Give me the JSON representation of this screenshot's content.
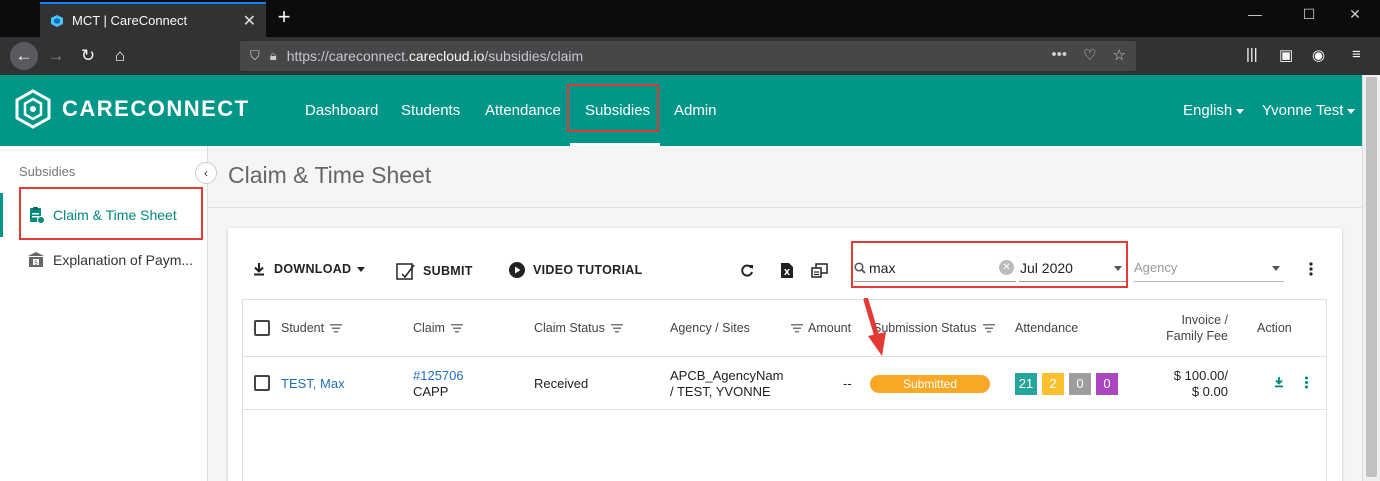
{
  "browser": {
    "tab_title": "MCT | CareConnect",
    "url_prefix": "https://careconnect.",
    "url_host": "carecloud.io",
    "url_path": "/subsidies/claim"
  },
  "app": {
    "brand": "CARECONNECT",
    "nav": [
      {
        "label": "Dashboard"
      },
      {
        "label": "Students"
      },
      {
        "label": "Attendance"
      },
      {
        "label": "Subsidies"
      },
      {
        "label": "Admin"
      }
    ],
    "active_nav": "Subsidies",
    "language": "English",
    "user": "Yvonne Test"
  },
  "sidebar": {
    "header": "Subsidies",
    "items": [
      {
        "label": "Claim & Time Sheet",
        "active": true
      },
      {
        "label": "Explanation of Paym..."
      }
    ]
  },
  "page": {
    "title": "Claim & Time Sheet"
  },
  "toolbar": {
    "download": "DOWNLOAD",
    "submit": "SUBMIT",
    "video_tutorial": "VIDEO TUTORIAL",
    "search_value": "max",
    "month": "Jul 2020",
    "agency_placeholder": "Agency"
  },
  "table": {
    "headers": {
      "student": "Student",
      "claim": "Claim",
      "claim_status": "Claim Status",
      "agency_sites": "Agency / Sites",
      "amount": "Amount",
      "submission_status": "Submission Status",
      "attendance": "Attendance",
      "invoice_line1": "Invoice /",
      "invoice_line2": "Family Fee",
      "action": "Action"
    },
    "rows": [
      {
        "student": "TEST, Max",
        "claim_id": "#125706",
        "claim_program": "CAPP",
        "claim_status": "Received",
        "agency_line1": "APCB_AgencyNam",
        "agency_line2": "/ TEST, YVONNE",
        "amount": "--",
        "submission_status": "Submitted",
        "attendance": [
          "21",
          "2",
          "0",
          "0"
        ],
        "invoice": "$ 100.00/",
        "family_fee": "$ 0.00"
      }
    ]
  },
  "colors": {
    "primary": "#009688",
    "highlight": "#e53935",
    "submitted": "#f9a825",
    "att_green": "#26a69a",
    "att_yellow": "#fbc02d",
    "att_grey": "#9e9e9e",
    "att_purple": "#ab47bc"
  }
}
